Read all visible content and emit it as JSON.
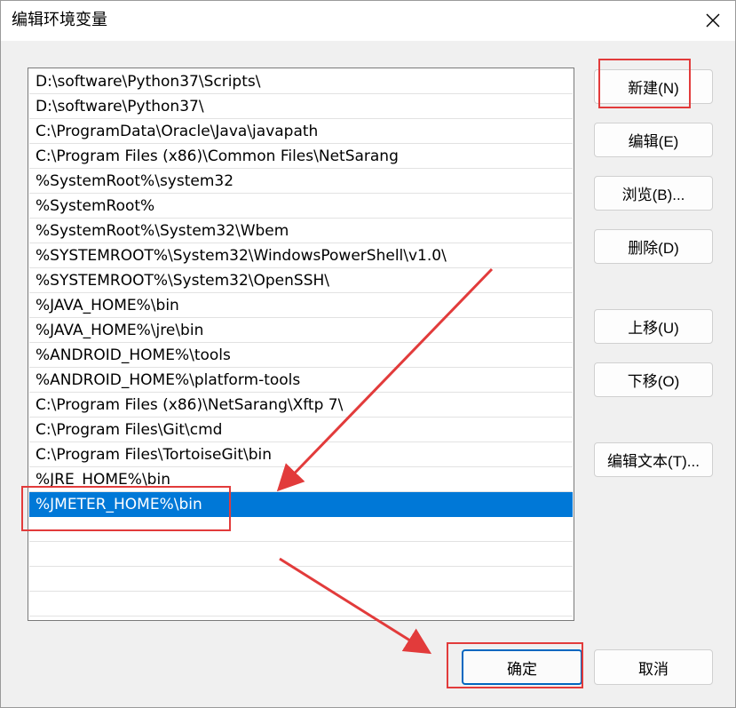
{
  "window": {
    "title": "编辑环境变量",
    "close_icon": "close-icon"
  },
  "path_entries": [
    "D:\\software\\Python37\\Scripts\\",
    "D:\\software\\Python37\\",
    "C:\\ProgramData\\Oracle\\Java\\javapath",
    "C:\\Program Files (x86)\\Common Files\\NetSarang",
    "%SystemRoot%\\system32",
    "%SystemRoot%",
    "%SystemRoot%\\System32\\Wbem",
    "%SYSTEMROOT%\\System32\\WindowsPowerShell\\v1.0\\",
    "%SYSTEMROOT%\\System32\\OpenSSH\\",
    "%JAVA_HOME%\\bin",
    "%JAVA_HOME%\\jre\\bin",
    "%ANDROID_HOME%\\tools",
    "%ANDROID_HOME%\\platform-tools",
    "C:\\Program Files (x86)\\NetSarang\\Xftp 7\\",
    "C:\\Program Files\\Git\\cmd",
    "C:\\Program Files\\TortoiseGit\\bin",
    "%JRE_HOME%\\bin",
    "%JMETER_HOME%\\bin"
  ],
  "selected_index": 17,
  "side_buttons": {
    "new": "新建(N)",
    "edit": "编辑(E)",
    "browse": "浏览(B)...",
    "delete": "删除(D)",
    "move_up": "上移(U)",
    "move_down": "下移(O)",
    "edit_text": "编辑文本(T)..."
  },
  "footer_buttons": {
    "ok": "确定",
    "cancel": "取消"
  },
  "colors": {
    "selection": "#0078d7",
    "annotation": "#e23b3b",
    "primary_border": "#0067c0"
  }
}
